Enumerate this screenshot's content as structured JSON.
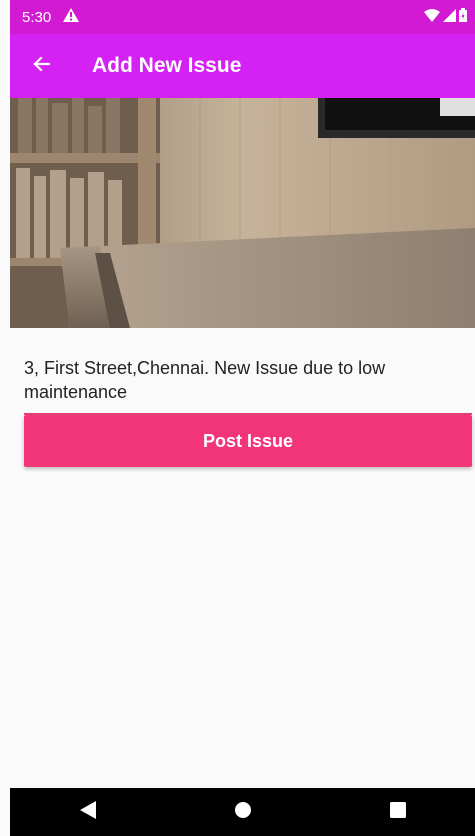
{
  "status_bar": {
    "time": "5:30",
    "icons": [
      "warning-icon",
      "wifi-icon",
      "signal-icon",
      "battery-icon"
    ],
    "color": "#d21ad3"
  },
  "app_bar": {
    "title": "Add New Issue",
    "back_icon": "arrow-left-icon",
    "color": "#d422f5"
  },
  "hero_image": {
    "description_icon": "room-photo"
  },
  "issue": {
    "text": "3, First Street,Chennai. New Issue due to low maintenance",
    "underline_color": "#ec407a"
  },
  "post_button": {
    "label": "Post Issue",
    "color": "#f23579"
  },
  "nav_bar": {
    "back_icon": "triangle-back-icon",
    "home_icon": "circle-home-icon",
    "recents_icon": "square-recents-icon"
  }
}
